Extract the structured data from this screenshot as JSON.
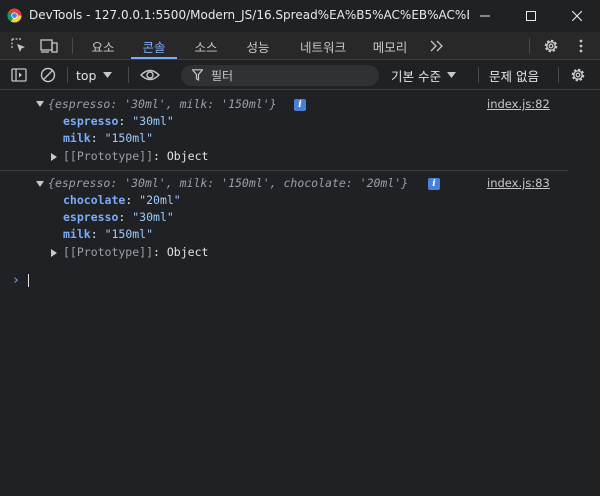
{
  "window": {
    "title": "DevTools - 127.0.0.1:5500/Modern_JS/16.Spread%EA%B5%AC%EB%AC%B8/in..."
  },
  "tabs": [
    {
      "label": "요소"
    },
    {
      "label": "콘솔",
      "active": true
    },
    {
      "label": "소스"
    },
    {
      "label": "성능"
    },
    {
      "label": "네트워크"
    },
    {
      "label": "메모리"
    }
  ],
  "toolbar": {
    "context": "top",
    "filter_placeholder": "필터",
    "level": "기본 수준",
    "issues": "문제 없음"
  },
  "console": {
    "entries": [
      {
        "summary": {
          "open": "{",
          "k1": "espresso",
          "v1": "'30ml'",
          "k2": "milk",
          "v2": "'150ml'",
          "close": "}"
        },
        "source": "index.js:82",
        "props": [
          {
            "key": "espresso",
            "value": "\"30ml\""
          },
          {
            "key": "milk",
            "value": "\"150ml\""
          }
        ],
        "prototype": {
          "key": "[[Prototype]]",
          "value": "Object"
        }
      },
      {
        "summary": {
          "open": "{",
          "k1": "espresso",
          "v1": "'30ml'",
          "k2": "milk",
          "v2": "'150ml'",
          "k3": "chocolate",
          "v3": "'20ml'",
          "close": "}"
        },
        "source": "index.js:83",
        "props": [
          {
            "key": "chocolate",
            "value": "\"20ml\""
          },
          {
            "key": "espresso",
            "value": "\"30ml\""
          },
          {
            "key": "milk",
            "value": "\"150ml\""
          }
        ],
        "prototype": {
          "key": "[[Prototype]]",
          "value": "Object"
        }
      }
    ],
    "prompt_symbol": "›"
  },
  "colors": {
    "accent": "#7cacf8",
    "background": "#202124",
    "string": "#9ecbff"
  }
}
